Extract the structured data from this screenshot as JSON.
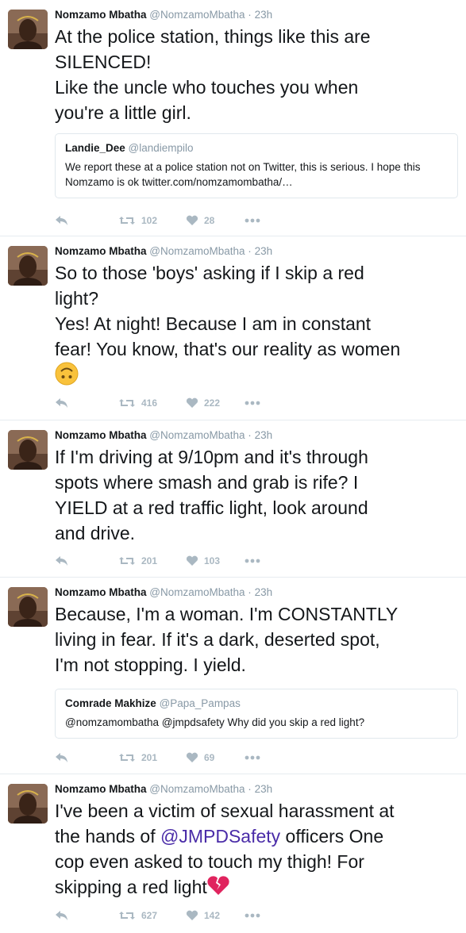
{
  "tweets": [
    {
      "name": "Nomzamo Mbatha",
      "handle": "@NomzamoMbatha",
      "dot": "·",
      "time": "23h",
      "lines": [
        "At the police station, things like this are",
        "SILENCED!",
        "Like the uncle who touches you when",
        "you're a little girl."
      ],
      "quote": {
        "name": "Landie_Dee",
        "handle": "@landiempilo",
        "text_lines": [
          "We report these at a police station not on Twitter, this is serious. I hope this",
          "Nomzamo is ok twitter.com/nomzamombatha/…"
        ]
      },
      "retweets": "102",
      "likes": "28"
    },
    {
      "name": "Nomzamo Mbatha",
      "handle": "@NomzamoMbatha",
      "dot": "·",
      "time": "23h",
      "lines": [
        "So to those 'boys' asking if I skip a red",
        "light?",
        "Yes! At night! Because I am in constant",
        "fear! You know, that's our reality as women"
      ],
      "emoji": "upside-down-face-icon",
      "retweets": "416",
      "likes": "222"
    },
    {
      "name": "Nomzamo Mbatha",
      "handle": "@NomzamoMbatha",
      "dot": "·",
      "time": "23h",
      "lines": [
        "If I'm driving at 9/10pm and it's through",
        "spots where smash and grab is rife? I",
        "YIELD at a red traffic light, look around",
        "and drive."
      ],
      "retweets": "201",
      "likes": "103"
    },
    {
      "name": "Nomzamo Mbatha",
      "handle": "@NomzamoMbatha",
      "dot": "·",
      "time": "23h",
      "lines": [
        "Because, I'm a woman. I'm CONSTANTLY",
        "living in fear. If it's a dark, deserted spot,",
        "I'm not stopping. I yield."
      ],
      "quote": {
        "name": "Comrade Makhize",
        "handle": "@Papa_Pampas",
        "text_lines": [
          "@nomzamombatha @jmpdsafety Why did you skip a red light?"
        ]
      },
      "retweets": "201",
      "likes": "69"
    },
    {
      "name": "Nomzamo Mbatha",
      "handle": "@NomzamoMbatha",
      "dot": "·",
      "time": "23h",
      "line1": "I've been a victim of sexual harassment at",
      "line2_pre": "the hands of ",
      "mention": "@JMPDSafety",
      "line2_post": " officers One",
      "line3": "cop even asked to touch my thigh! For",
      "line4": "skipping a red light",
      "emoji": "broken-heart-icon",
      "retweets": "627",
      "likes": "142"
    }
  ],
  "icons": {
    "reply": "reply-icon",
    "retweet": "retweet-icon",
    "like": "heart-icon",
    "more": "more-icon"
  },
  "colors": {
    "mention": "#4a2ca8",
    "muted": "#8899a6",
    "action": "#aab8c2"
  }
}
